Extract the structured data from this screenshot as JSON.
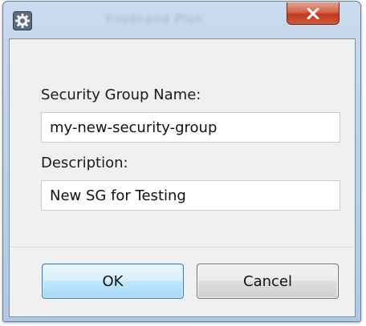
{
  "window": {
    "icon": "gear-icon",
    "close_icon": "close-icon",
    "blurred_background_text": "Firebrand    Plan"
  },
  "form": {
    "name_label": "Security Group Name:",
    "name_value": "my-new-security-group",
    "description_label": "Description:",
    "description_value": "New SG for Testing"
  },
  "buttons": {
    "ok_label": "OK",
    "cancel_label": "Cancel"
  },
  "colors": {
    "close_button": "#c0391d",
    "ok_button_border": "#3c7fb1",
    "client_background": "#f0f0f0"
  }
}
